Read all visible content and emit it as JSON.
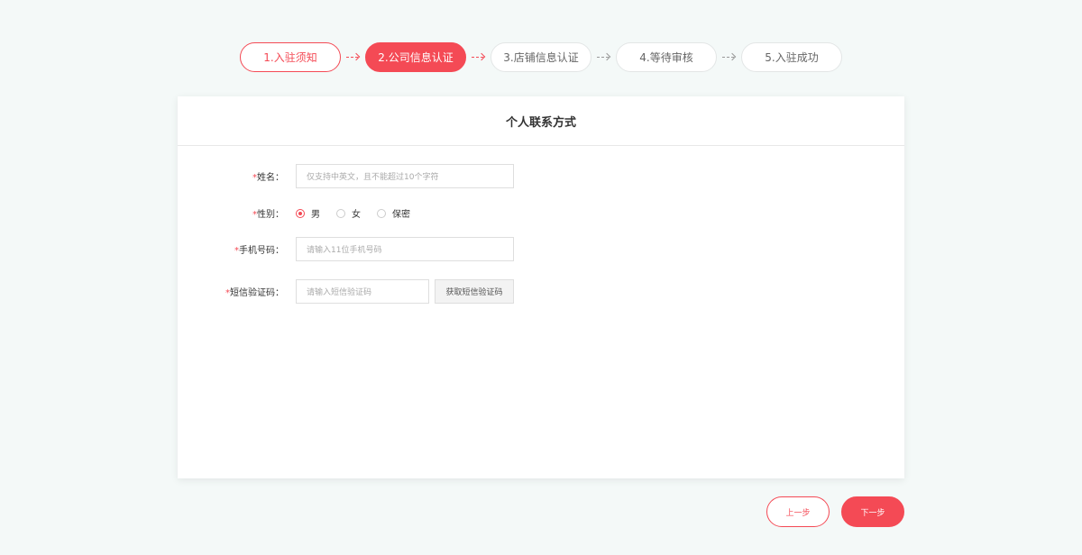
{
  "colors": {
    "accent": "#f44a55",
    "background": "#f4f9f8"
  },
  "steps": [
    {
      "label": "1.入驻须知",
      "state": "done"
    },
    {
      "label": "2.公司信息认证",
      "state": "active"
    },
    {
      "label": "3.店铺信息认证",
      "state": "pending"
    },
    {
      "label": "4.等待审核",
      "state": "pending"
    },
    {
      "label": "5.入驻成功",
      "state": "pending"
    }
  ],
  "card": {
    "title": "个人联系方式"
  },
  "form": {
    "required_mark": "*",
    "name": {
      "label": "姓名：",
      "placeholder": "仅支持中英文，且不能超过10个字符"
    },
    "gender": {
      "label": "性别：",
      "options": [
        "男",
        "女",
        "保密"
      ],
      "selected": "男"
    },
    "phone": {
      "label": "手机号码：",
      "placeholder": "请输入11位手机号码"
    },
    "sms": {
      "label": "短信验证码：",
      "placeholder": "请输入短信验证码",
      "button": "获取短信验证码"
    }
  },
  "buttons": {
    "prev": "上一步",
    "next": "下一步"
  }
}
